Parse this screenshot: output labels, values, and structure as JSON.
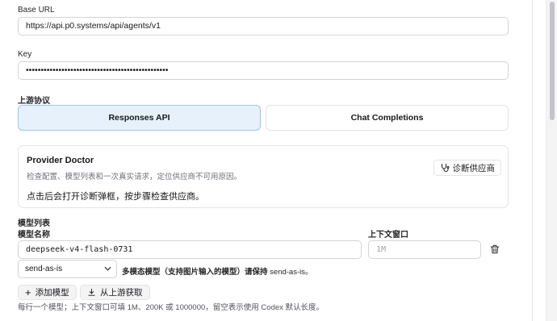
{
  "form": {
    "base_url_label": "Base URL",
    "base_url_value": "https://api.p0.systems/api/agents/v1",
    "key_label": "Key",
    "key_value": "••••••••••••••••••••••••••••••••••••••••••••••••",
    "protocol_label": "上游协议",
    "protocol_options": [
      "Responses API",
      "Chat Completions"
    ],
    "protocol_selected": "Responses API"
  },
  "doctor": {
    "title": "Provider Doctor",
    "subtitle": "检查配置、模型列表和一次真实请求，定位供应商不可用原因。",
    "hint": "点击后会打开诊断弹框，按步骤检查供应商。",
    "button_label": "诊断供应商",
    "button_icon": "stethoscope-icon"
  },
  "models": {
    "section_label": "模型列表",
    "name_col_label": "模型名称",
    "context_col_label": "上下文窗口",
    "rows": [
      {
        "name": "deepseek-v4-flash-0731",
        "context_placeholder": "1M"
      }
    ],
    "mode_select_value": "send-as-is",
    "multimodal_note_bold": "多模态模型（支持图片输入的模型）请保持",
    "multimodal_note_rest": " send-as-is。",
    "add_model_label": "添加模型",
    "fetch_upstream_label": "从上游获取",
    "help_text": "每行一个模型；上下文窗口可填 1M、200K 或 1000000，留空表示使用 Codex 默认长度。"
  },
  "colors": {
    "accent_bg": "#e6f1fb",
    "accent_border": "#9ec5ea"
  }
}
